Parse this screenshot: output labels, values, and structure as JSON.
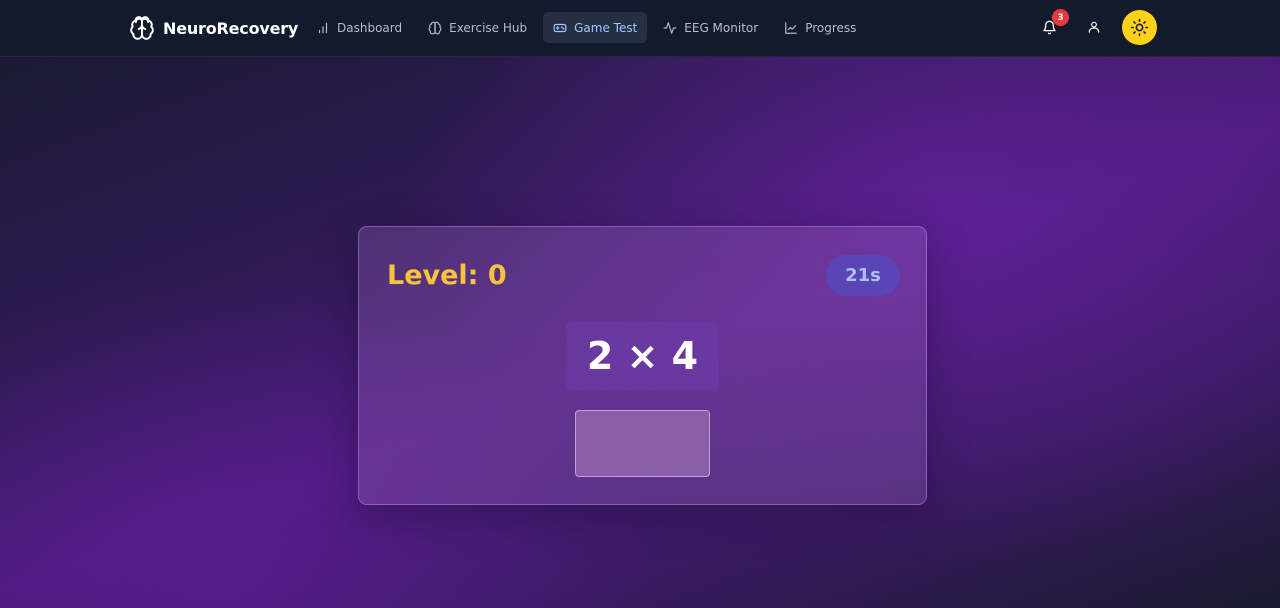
{
  "app": {
    "name": "NeuroRecovery"
  },
  "nav": {
    "items": [
      {
        "label": "Dashboard",
        "icon": "bar-chart-icon"
      },
      {
        "label": "Exercise Hub",
        "icon": "brain-icon"
      },
      {
        "label": "Game Test",
        "icon": "gamepad-icon",
        "active": true
      },
      {
        "label": "EEG Monitor",
        "icon": "activity-icon"
      },
      {
        "label": "Progress",
        "icon": "trending-up-icon"
      }
    ],
    "active_color": "#9fc6ff"
  },
  "header": {
    "notifications_count": "3",
    "notification_badge_color": "#e5393c",
    "theme_button_color": "#ffd11a"
  },
  "game": {
    "level_text": "Level: 0",
    "timer_text": "21s",
    "problem_text": "2 × 4",
    "answer_value": "",
    "level_color": "#f6c33a",
    "timer_bg": "#5a44b6"
  }
}
